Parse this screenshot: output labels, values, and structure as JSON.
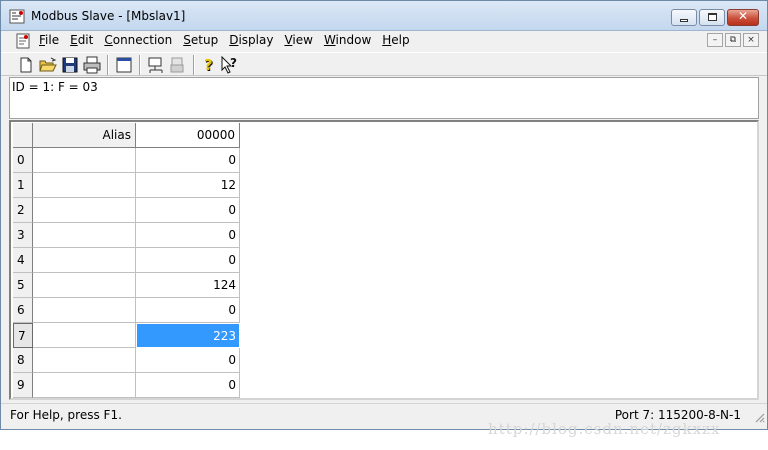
{
  "window": {
    "title": "Modbus Slave - [Mbslav1]",
    "caption_buttons": [
      "minimize-icon",
      "maximize-icon",
      "close-icon"
    ]
  },
  "menu": {
    "items": [
      {
        "label": "File",
        "mnemonic": "F",
        "rest": "ile"
      },
      {
        "label": "Edit",
        "mnemonic": "E",
        "rest": "dit"
      },
      {
        "label": "Connection",
        "mnemonic": "C",
        "rest": "onnection"
      },
      {
        "label": "Setup",
        "mnemonic": "S",
        "rest": "etup"
      },
      {
        "label": "Display",
        "mnemonic": "D",
        "rest": "isplay"
      },
      {
        "label": "View",
        "mnemonic": "V",
        "rest": "iew"
      },
      {
        "label": "Window",
        "mnemonic": "W",
        "rest": "indow"
      },
      {
        "label": "Help",
        "mnemonic": "H",
        "rest": "elp"
      }
    ],
    "mdi_buttons": {
      "minimize": "–",
      "restore": "⧉",
      "close": "×"
    }
  },
  "toolbar": {
    "icons": [
      "new-document-icon",
      "open-folder-icon",
      "save-icon",
      "print-icon",
      "window-icon",
      "connect-icon",
      "disconnect-icon",
      "help-icon",
      "context-help-icon"
    ]
  },
  "info": {
    "text": "ID = 1: F = 03"
  },
  "grid": {
    "columns": [
      "Alias",
      "00000"
    ],
    "rows": [
      {
        "index": "0",
        "alias": "",
        "value": "0"
      },
      {
        "index": "1",
        "alias": "",
        "value": "12"
      },
      {
        "index": "2",
        "alias": "",
        "value": "0"
      },
      {
        "index": "3",
        "alias": "",
        "value": "0"
      },
      {
        "index": "4",
        "alias": "",
        "value": "0"
      },
      {
        "index": "5",
        "alias": "",
        "value": "124"
      },
      {
        "index": "6",
        "alias": "",
        "value": "0"
      },
      {
        "index": "7",
        "alias": "",
        "value": "223"
      },
      {
        "index": "8",
        "alias": "",
        "value": "0"
      },
      {
        "index": "9",
        "alias": "",
        "value": "0"
      }
    ],
    "selected_row": 7,
    "selection_color": "#3399ff"
  },
  "status": {
    "left": "For Help, press F1.",
    "right": "Port 7: 115200-8-N-1"
  },
  "watermark": "http://blog.csdn.net/zgkxzx"
}
